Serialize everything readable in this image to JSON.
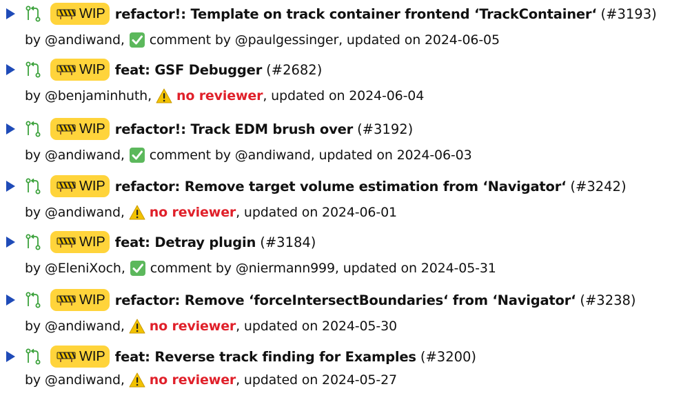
{
  "colors": {
    "bullet": "#1f4bb8",
    "pr_icon": "#3aa13a",
    "wip_badge": "#ffd43b",
    "check_bg": "#5cb85c",
    "warning": "#f2c200",
    "no_reviewer": "#e0202a"
  },
  "icons": {
    "bullet": "triangle-right-icon",
    "pr": "pull-request-icon",
    "wip": "construction-barrier-icon",
    "approved": "check-mark-icon",
    "warning": "warning-icon"
  },
  "items": [
    {
      "wip": "WIP",
      "title": "refactor!: Template on track container frontend ‘TrackContainer‘",
      "number": "(#3193)",
      "by": "by @andiwand,",
      "status_type": "comment",
      "status_text": "comment by @paulgessinger",
      "updated": ", updated on 2024-06-05"
    },
    {
      "wip": "WIP",
      "title": "feat: GSF Debugger",
      "number": "(#2682)",
      "by": "by @benjaminhuth,",
      "status_type": "warning",
      "status_text": "no reviewer",
      "updated": ", updated on 2024-06-04"
    },
    {
      "wip": "WIP",
      "title": "refactor!: Track EDM brush over",
      "number": "(#3192)",
      "by": "by @andiwand,",
      "status_type": "comment",
      "status_text": "comment by @andiwand",
      "updated": ", updated on 2024-06-03"
    },
    {
      "wip": "WIP",
      "title": "refactor: Remove target volume estimation from ‘Navigator‘",
      "number": "(#3242)",
      "by": "by @andiwand,",
      "status_type": "warning",
      "status_text": "no reviewer",
      "updated": ", updated on 2024-06-01"
    },
    {
      "wip": "WIP",
      "title": "feat: Detray plugin",
      "number": "(#3184)",
      "by": "by @EleniXoch,",
      "status_type": "comment",
      "status_text": "comment by @niermann999",
      "updated": ", updated on 2024-05-31"
    },
    {
      "wip": "WIP",
      "title": "refactor: Remove ‘forceIntersectBoundaries‘ from ‘Navigator‘",
      "number": "(#3238)",
      "by": "by @andiwand,",
      "status_type": "warning",
      "status_text": "no reviewer",
      "updated": ", updated on 2024-05-30"
    },
    {
      "wip": "WIP",
      "title": "feat: Reverse track finding for Examples",
      "number": "(#3200)",
      "by": "by @andiwand,",
      "status_type": "warning",
      "status_text": "no reviewer",
      "updated": ", updated on 2024-05-27"
    }
  ]
}
